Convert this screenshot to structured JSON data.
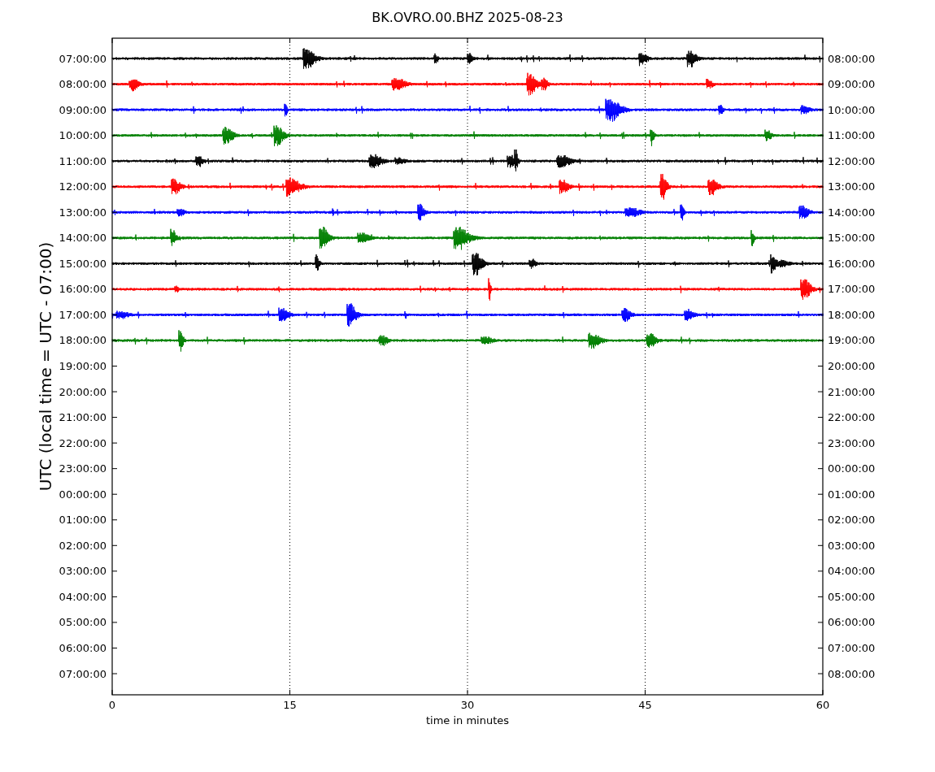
{
  "title": "BK.OVRO.00.BHZ 2025-08-23",
  "ylabel": "UTC (local time = UTC - 07:00)",
  "xlabel": "time in minutes",
  "xticks": [
    "0",
    "15",
    "30",
    "45",
    "60"
  ],
  "left_ticks": [
    "07:00:00",
    "08:00:00",
    "09:00:00",
    "10:00:00",
    "11:00:00",
    "12:00:00",
    "13:00:00",
    "14:00:00",
    "15:00:00",
    "16:00:00",
    "17:00:00",
    "18:00:00",
    "19:00:00",
    "20:00:00",
    "21:00:00",
    "22:00:00",
    "23:00:00",
    "00:00:00",
    "01:00:00",
    "02:00:00",
    "03:00:00",
    "04:00:00",
    "05:00:00",
    "06:00:00",
    "07:00:00"
  ],
  "right_ticks": [
    "08:00:00",
    "09:00:00",
    "10:00:00",
    "11:00:00",
    "12:00:00",
    "13:00:00",
    "14:00:00",
    "15:00:00",
    "16:00:00",
    "17:00:00",
    "18:00:00",
    "19:00:00",
    "20:00:00",
    "21:00:00",
    "22:00:00",
    "23:00:00",
    "00:00:00",
    "01:00:00",
    "02:00:00",
    "03:00:00",
    "04:00:00",
    "05:00:00",
    "06:00:00",
    "07:00:00",
    "08:00:00"
  ],
  "traces": [
    {
      "color": "#000000"
    },
    {
      "color": "#ff0000"
    },
    {
      "color": "#0000ff"
    },
    {
      "color": "#008000"
    },
    {
      "color": "#000000"
    },
    {
      "color": "#ff0000"
    },
    {
      "color": "#0000ff"
    },
    {
      "color": "#008000"
    },
    {
      "color": "#000000"
    },
    {
      "color": "#ff0000"
    },
    {
      "color": "#0000ff"
    },
    {
      "color": "#008000"
    }
  ]
}
